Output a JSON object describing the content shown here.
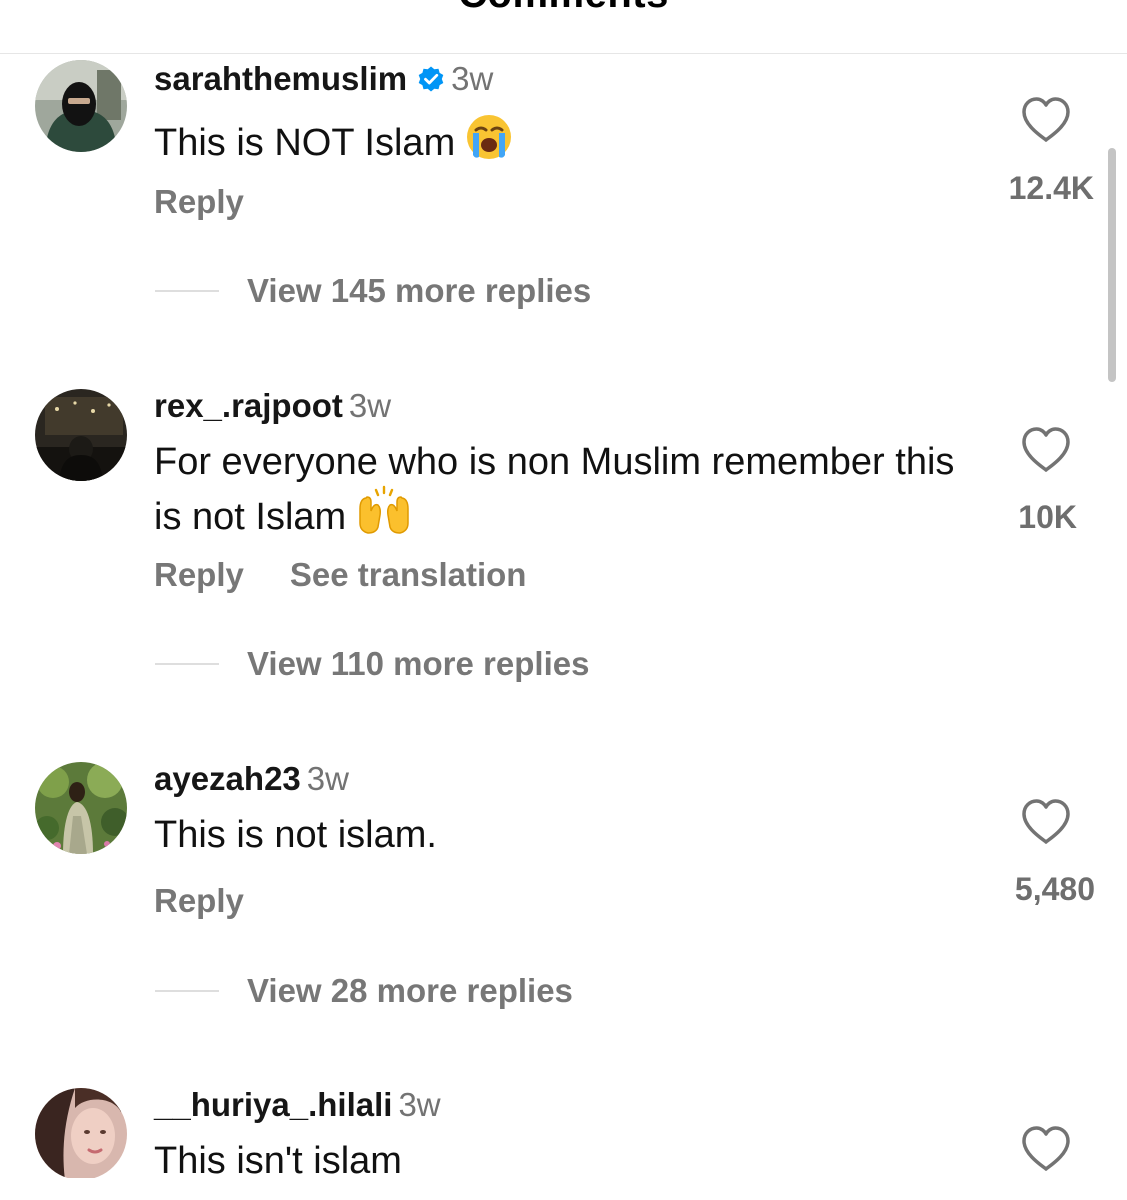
{
  "header": {
    "title": "Comments"
  },
  "comments": [
    {
      "username": "sarahthemuslim",
      "verified": true,
      "time": "3w",
      "text": "This is NOT Islam",
      "emoji": "loudly-crying-face",
      "actions": [
        "Reply"
      ],
      "likes": "12.4K",
      "view_replies": "View 145 more replies"
    },
    {
      "username": "rex_.rajpoot",
      "verified": false,
      "time": "3w",
      "text": "For everyone who is non Muslim remember this is not Islam",
      "emoji": "raising-hands",
      "actions": [
        "Reply",
        "See translation"
      ],
      "likes": "10K",
      "view_replies": "View 110 more replies"
    },
    {
      "username": "ayezah23",
      "verified": false,
      "time": "3w",
      "text": "This is not islam.",
      "actions": [
        "Reply"
      ],
      "likes": "5,480",
      "view_replies": "View 28 more replies"
    },
    {
      "username": "__huriya_.hilali",
      "verified": false,
      "time": "3w",
      "text": "This isn't islam"
    }
  ],
  "colors": {
    "verified_badge": "#0095f6",
    "secondary_text": "#737373",
    "action_text": "#777777"
  }
}
